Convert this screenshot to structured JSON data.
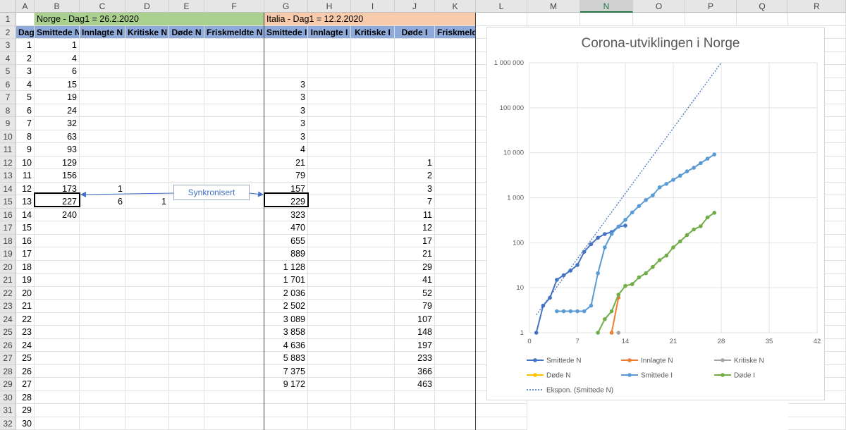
{
  "columns": [
    "A",
    "B",
    "C",
    "D",
    "E",
    "F",
    "G",
    "H",
    "I",
    "J",
    "K",
    "L",
    "M",
    "N",
    "O",
    "P",
    "Q",
    "R"
  ],
  "selected_column": "N",
  "rows": [
    "1",
    "2",
    "3",
    "4",
    "5",
    "6",
    "7",
    "8",
    "9",
    "10",
    "11",
    "12",
    "13",
    "14",
    "15",
    "16",
    "17",
    "18",
    "19",
    "20",
    "21",
    "22",
    "23",
    "24",
    "25",
    "26",
    "27",
    "28",
    "29",
    "30",
    "31",
    "32"
  ],
  "header_norge": "Norge - Dag1 = 26.2.2020",
  "header_italia": "Italia - Dag1 = 12.2.2020",
  "subheaders": [
    "Dag",
    "Smittede N",
    "Innlagte N",
    "Kritiske N",
    "Døde N",
    "Friskmeldte N",
    "Smittede I",
    "Innlagte I",
    "Kritiske I",
    "Døde I",
    "Friskmeldte I"
  ],
  "table": [
    [
      "1",
      "1",
      "",
      "",
      "",
      "",
      "",
      "",
      "",
      "",
      ""
    ],
    [
      "2",
      "4",
      "",
      "",
      "",
      "",
      "",
      "",
      "",
      "",
      ""
    ],
    [
      "3",
      "6",
      "",
      "",
      "",
      "",
      "",
      "",
      "",
      "",
      ""
    ],
    [
      "4",
      "15",
      "",
      "",
      "",
      "",
      "3",
      "",
      "",
      "",
      ""
    ],
    [
      "5",
      "19",
      "",
      "",
      "",
      "",
      "3",
      "",
      "",
      "",
      ""
    ],
    [
      "6",
      "24",
      "",
      "",
      "",
      "",
      "3",
      "",
      "",
      "",
      ""
    ],
    [
      "7",
      "32",
      "",
      "",
      "",
      "",
      "3",
      "",
      "",
      "",
      ""
    ],
    [
      "8",
      "63",
      "",
      "",
      "",
      "",
      "3",
      "",
      "",
      "",
      ""
    ],
    [
      "9",
      "93",
      "",
      "",
      "",
      "",
      "4",
      "",
      "",
      "",
      ""
    ],
    [
      "10",
      "129",
      "",
      "",
      "",
      "",
      "21",
      "",
      "",
      "1",
      ""
    ],
    [
      "11",
      "156",
      "",
      "",
      "",
      "",
      "79",
      "",
      "",
      "2",
      ""
    ],
    [
      "12",
      "173",
      "1",
      "",
      "",
      "",
      "157",
      "",
      "",
      "3",
      ""
    ],
    [
      "13",
      "227",
      "6",
      "1",
      "",
      "",
      "229",
      "",
      "",
      "7",
      ""
    ],
    [
      "14",
      "240",
      "",
      "",
      "",
      "",
      "323",
      "",
      "",
      "11",
      ""
    ],
    [
      "15",
      "",
      "",
      "",
      "",
      "",
      "470",
      "",
      "",
      "12",
      ""
    ],
    [
      "16",
      "",
      "",
      "",
      "",
      "",
      "655",
      "",
      "",
      "17",
      ""
    ],
    [
      "17",
      "",
      "",
      "",
      "",
      "",
      "889",
      "",
      "",
      "21",
      ""
    ],
    [
      "18",
      "",
      "",
      "",
      "",
      "",
      "1 128",
      "",
      "",
      "29",
      ""
    ],
    [
      "19",
      "",
      "",
      "",
      "",
      "",
      "1 701",
      "",
      "",
      "41",
      ""
    ],
    [
      "20",
      "",
      "",
      "",
      "",
      "",
      "2 036",
      "",
      "",
      "52",
      ""
    ],
    [
      "21",
      "",
      "",
      "",
      "",
      "",
      "2 502",
      "",
      "",
      "79",
      ""
    ],
    [
      "22",
      "",
      "",
      "",
      "",
      "",
      "3 089",
      "",
      "",
      "107",
      ""
    ],
    [
      "23",
      "",
      "",
      "",
      "",
      "",
      "3 858",
      "",
      "",
      "148",
      ""
    ],
    [
      "24",
      "",
      "",
      "",
      "",
      "",
      "4 636",
      "",
      "",
      "197",
      ""
    ],
    [
      "25",
      "",
      "",
      "",
      "",
      "",
      "5 883",
      "",
      "",
      "233",
      ""
    ],
    [
      "26",
      "",
      "",
      "",
      "",
      "",
      "7 375",
      "",
      "",
      "366",
      ""
    ],
    [
      "27",
      "",
      "",
      "",
      "",
      "",
      "9 172",
      "",
      "",
      "463",
      ""
    ],
    [
      "28",
      "",
      "",
      "",
      "",
      "",
      "",
      "",
      "",
      "",
      ""
    ],
    [
      "29",
      "",
      "",
      "",
      "",
      "",
      "",
      "",
      "",
      "",
      ""
    ],
    [
      "30",
      "",
      "",
      "",
      "",
      "",
      "",
      "",
      "",
      "",
      ""
    ]
  ],
  "shape_label": "Synkronisert",
  "chart_data": {
    "type": "scatter",
    "title": "Corona-utviklingen i Norge",
    "yscale": "log",
    "ylim": [
      1,
      1000000
    ],
    "xlim": [
      0,
      42
    ],
    "xticks": [
      "0",
      "7",
      "14",
      "21",
      "28",
      "35",
      "42"
    ],
    "yticks": [
      "1",
      "10",
      "100",
      "1 000",
      "10 000",
      "100 000",
      "1 000 000"
    ],
    "grid": true,
    "legend_position": "bottom",
    "series": [
      {
        "name": "Smittede N",
        "color": "#4472c4",
        "x": [
          1,
          2,
          3,
          4,
          5,
          6,
          7,
          8,
          9,
          10,
          11,
          12,
          13,
          14
        ],
        "y": [
          1,
          4,
          6,
          15,
          19,
          24,
          32,
          63,
          93,
          129,
          156,
          173,
          227,
          240
        ]
      },
      {
        "name": "Innlagte N",
        "color": "#ed7d31",
        "x": [
          12,
          13
        ],
        "y": [
          1,
          6
        ]
      },
      {
        "name": "Kritiske N",
        "color": "#a5a5a5",
        "x": [
          13
        ],
        "y": [
          1
        ]
      },
      {
        "name": "Døde N",
        "color": "#ffc000",
        "x": [],
        "y": []
      },
      {
        "name": "Smittede I",
        "color": "#5b9bd5",
        "x": [
          4,
          5,
          6,
          7,
          8,
          9,
          10,
          11,
          12,
          13,
          14,
          15,
          16,
          17,
          18,
          19,
          20,
          21,
          22,
          23,
          24,
          25,
          26,
          27
        ],
        "y": [
          3,
          3,
          3,
          3,
          3,
          4,
          21,
          79,
          157,
          229,
          323,
          470,
          655,
          889,
          1128,
          1701,
          2036,
          2502,
          3089,
          3858,
          4636,
          5883,
          7375,
          9172
        ]
      },
      {
        "name": "Døde I",
        "color": "#70ad47",
        "x": [
          10,
          11,
          12,
          13,
          14,
          15,
          16,
          17,
          18,
          19,
          20,
          21,
          22,
          23,
          24,
          25,
          26,
          27
        ],
        "y": [
          1,
          2,
          3,
          7,
          11,
          12,
          17,
          21,
          29,
          41,
          52,
          79,
          107,
          148,
          197,
          233,
          366,
          463
        ]
      }
    ],
    "trendline": {
      "name": "Ekspon. (Smittede N)",
      "color": "#4472c4",
      "x": [
        1,
        28
      ],
      "y": [
        2.5,
        1000000
      ]
    }
  }
}
